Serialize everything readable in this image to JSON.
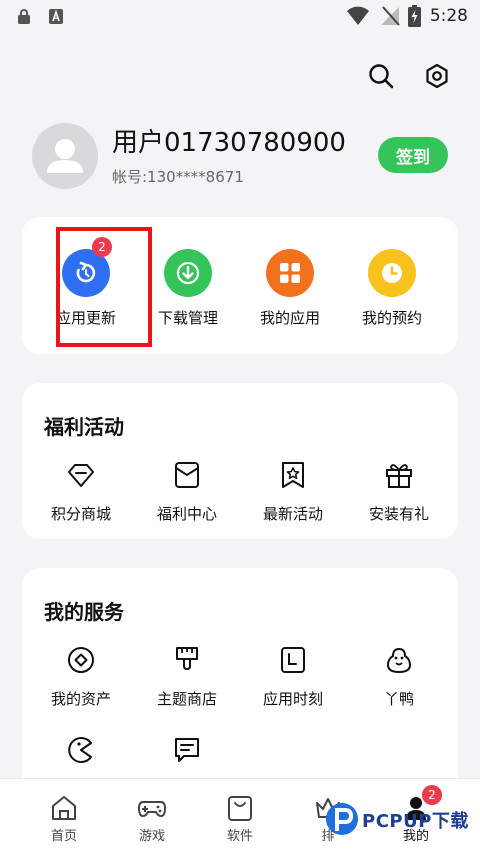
{
  "status_bar": {
    "time": "5:28"
  },
  "profile": {
    "username": "用户01730780900",
    "account": "帐号:130****8671",
    "signin_label": "签到"
  },
  "quick_actions": [
    {
      "label": "应用更新",
      "badge": "2",
      "color": "#2f6ff1",
      "icon": "refresh-icon"
    },
    {
      "label": "下载管理",
      "color": "#34c45a",
      "icon": "download-icon"
    },
    {
      "label": "我的应用",
      "color": "#f2711c",
      "icon": "grid-icon"
    },
    {
      "label": "我的预约",
      "color": "#f7c21b",
      "icon": "clock-icon"
    }
  ],
  "welfare": {
    "title": "福利活动",
    "items": [
      {
        "label": "积分商城",
        "icon": "diamond-icon"
      },
      {
        "label": "福利中心",
        "icon": "envelope-icon"
      },
      {
        "label": "最新活动",
        "icon": "star-bookmark-icon"
      },
      {
        "label": "安装有礼",
        "icon": "gift-icon"
      }
    ]
  },
  "services": {
    "title": "我的服务",
    "items": [
      {
        "label": "我的资产",
        "icon": "coin-icon"
      },
      {
        "label": "主题商店",
        "icon": "brush-icon"
      },
      {
        "label": "应用时刻",
        "icon": "calendar-icon"
      },
      {
        "label": "丫鸭",
        "icon": "duck-icon"
      },
      {
        "label": "",
        "icon": "pacman-icon"
      },
      {
        "label": "",
        "icon": "feedback-icon"
      }
    ]
  },
  "bottom_nav": [
    {
      "label": "首页",
      "icon": "home-icon"
    },
    {
      "label": "游戏",
      "icon": "gamepad-icon"
    },
    {
      "label": "软件",
      "icon": "bag-icon"
    },
    {
      "label": "排",
      "icon": "crown-icon"
    },
    {
      "label": "我的",
      "badge": "2",
      "icon": "person-icon"
    }
  ],
  "watermark": {
    "text": "PCPUP下载"
  },
  "colors": {
    "accent_green": "#34c45a",
    "badge_red": "#ea3c4d",
    "highlight_red": "#e8151b"
  }
}
